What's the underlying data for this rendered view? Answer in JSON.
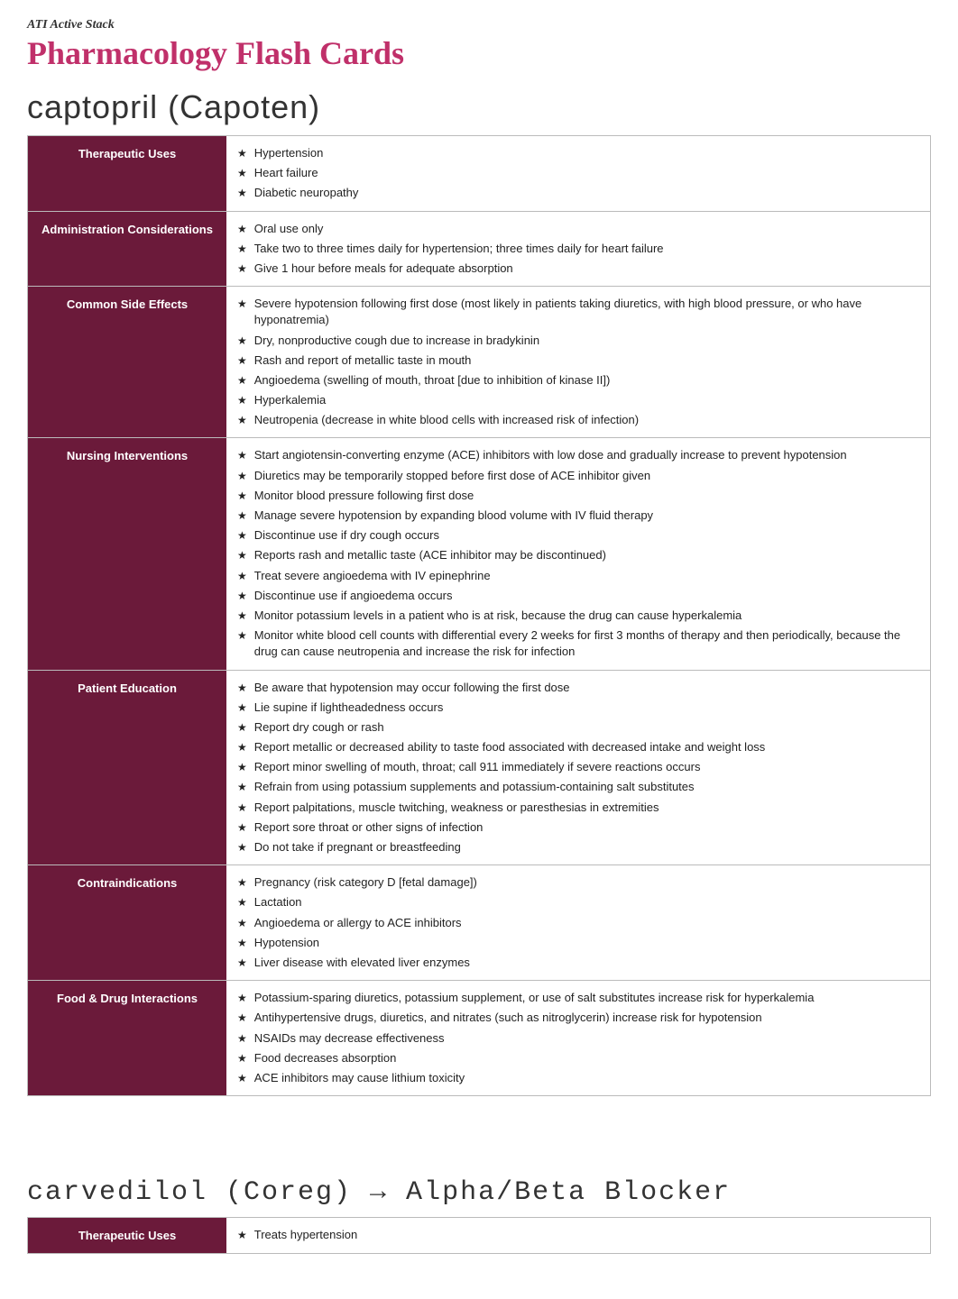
{
  "brand": "ATI Active Stack",
  "page_title": "Pharmacology Flash Cards",
  "card1": {
    "drug_title": "captopril (Capoten)",
    "rows": [
      {
        "label": "Therapeutic Uses",
        "bullets": [
          "Hypertension",
          "Heart failure",
          "Diabetic neuropathy"
        ]
      },
      {
        "label": "Administration Considerations",
        "bullets": [
          "Oral use only",
          "Take two to three times daily for hypertension; three times daily for heart failure",
          "Give 1 hour before meals for adequate absorption"
        ]
      },
      {
        "label": "Common Side Effects",
        "bullets": [
          "Severe hypotension following first dose (most likely in patients taking diuretics, with high blood pressure, or who have hyponatremia)",
          "Dry, nonproductive cough due to increase in bradykinin",
          "Rash and report of metallic taste in mouth",
          "Angioedema (swelling of mouth, throat [due to inhibition of kinase II])",
          "Hyperkalemia",
          "Neutropenia (decrease in white blood cells with increased risk of infection)"
        ]
      },
      {
        "label": "Nursing Interventions",
        "bullets": [
          "Start angiotensin-converting enzyme (ACE) inhibitors with low dose and gradually increase to prevent hypotension",
          "Diuretics may be temporarily stopped before first dose of ACE inhibitor given",
          "Monitor blood pressure following first dose",
          "Manage severe hypotension by expanding blood volume with IV fluid therapy",
          "Discontinue use if dry cough occurs",
          "Reports rash and metallic taste (ACE inhibitor may be discontinued)",
          "Treat severe angioedema with IV epinephrine",
          "Discontinue use if angioedema occurs",
          "Monitor potassium levels in a patient who is at risk, because the drug can cause hyperkalemia",
          "Monitor white blood cell counts with differential every 2 weeks for first 3 months of therapy and then periodically, because the drug can cause neutropenia and increase the risk for infection"
        ]
      },
      {
        "label": "Patient Education",
        "bullets": [
          "Be aware that hypotension may occur following the first dose",
          "Lie supine if lightheadedness occurs",
          "Report dry cough or rash",
          "Report metallic or decreased ability to taste food associated with decreased intake and weight loss",
          "Report minor swelling of mouth, throat; call 911 immediately if severe reactions occurs",
          "Refrain from using potassium supplements and potassium-containing salt substitutes",
          "Report palpitations, muscle twitching, weakness or paresthesias in extremities",
          "Report sore throat or other signs of infection",
          "Do not take if pregnant or breastfeeding"
        ]
      },
      {
        "label": "Contraindications",
        "bullets": [
          "Pregnancy (risk category D [fetal damage])",
          "Lactation",
          "Angioedema or allergy to ACE inhibitors",
          "Hypotension",
          "Liver disease with elevated liver enzymes"
        ]
      },
      {
        "label": "Food & Drug Interactions",
        "bullets": [
          "Potassium-sparing diuretics, potassium supplement, or use of salt substitutes increase risk for hyperkalemia",
          "Antihypertensive drugs, diuretics, and nitrates (such as nitroglycerin) increase risk for hypotension",
          "NSAIDs may decrease effectiveness",
          "Food decreases absorption",
          "ACE inhibitors may cause lithium toxicity"
        ]
      }
    ]
  },
  "card2": {
    "drug_title": "carvedilol (Coreg) → Alpha/Beta Blocker",
    "rows": [
      {
        "label": "Therapeutic Uses",
        "bullets": [
          "Treats hypertension"
        ]
      }
    ]
  }
}
